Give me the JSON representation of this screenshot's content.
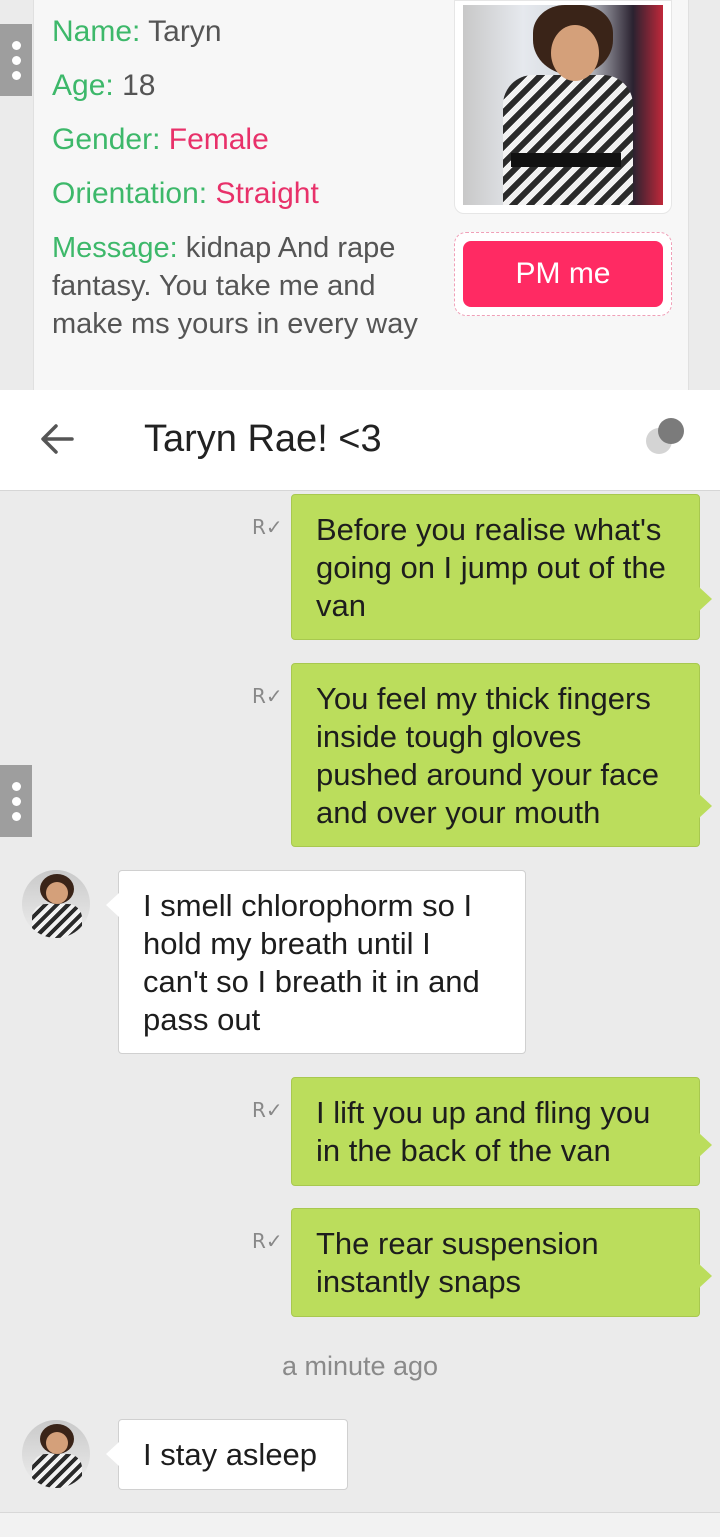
{
  "profile": {
    "name_key": "Name:",
    "name_value": "Taryn",
    "age_key": "Age:",
    "age_value": "18",
    "gender_key": "Gender:",
    "gender_value": "Female",
    "orientation_key": "Orientation:",
    "orientation_value": "Straight",
    "message_key": "Message:",
    "message_value": "kidnap And rape fantasy. You take me and make ms yours in every way",
    "pm_label": "PM me"
  },
  "header": {
    "title": "Taryn Rae! <3",
    "back_icon": "back-arrow-icon",
    "presence_icon": "presence-dots-icon"
  },
  "messages": [
    {
      "from": "me",
      "receipt": "R✓",
      "text": "Before you realise what's going on I jump out of the van"
    },
    {
      "from": "me",
      "receipt": "R✓",
      "text": "You feel my thick fingers inside tough gloves pushed around your face and over your mouth"
    },
    {
      "from": "them",
      "text": "I smell chlorophorm so I hold my breath until I can't so I breath it in and pass out"
    },
    {
      "from": "me",
      "receipt": "R✓",
      "text": "I lift you up and fling you in the back of the van"
    },
    {
      "from": "me",
      "receipt": "R✓",
      "text": "The rear suspension instantly snaps"
    },
    {
      "from": "them",
      "text": "I stay asleep"
    }
  ],
  "timestamp": "a minute ago",
  "colors": {
    "outgoing_bubble": "#bbdd5c",
    "label_green": "#3db86a",
    "accent_pink": "#e8316a",
    "pm_button": "#ff2a63"
  }
}
